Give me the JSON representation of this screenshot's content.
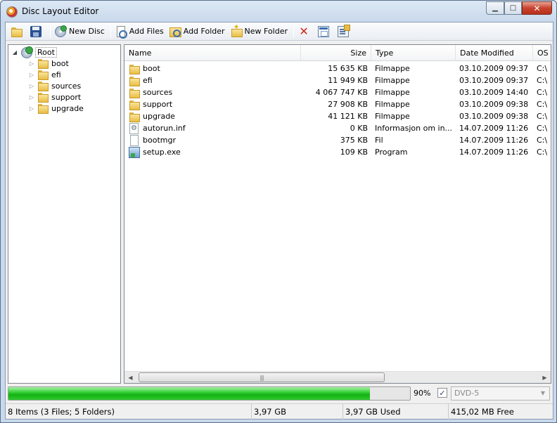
{
  "window": {
    "title": "Disc Layout Editor",
    "minimize_glyph": "▁",
    "maximize_glyph": "□",
    "close_glyph": "✕"
  },
  "toolbar": {
    "new_disc": "New Disc",
    "add_files": "Add Files",
    "add_folder": "Add Folder",
    "new_folder": "New Folder",
    "delete_glyph": "✕"
  },
  "tree": {
    "root": "Root",
    "items": [
      "boot",
      "efi",
      "sources",
      "support",
      "upgrade"
    ]
  },
  "list": {
    "columns": {
      "name": "Name",
      "size": "Size",
      "type": "Type",
      "date": "Date Modified",
      "os": "OS"
    },
    "rows": [
      {
        "icon": "folder-icon",
        "name": "boot",
        "size": "15 635 KB",
        "type": "Filmappe",
        "date": "03.10.2009 09:37",
        "os": "C:\\"
      },
      {
        "icon": "folder-icon",
        "name": "efi",
        "size": "11 949 KB",
        "type": "Filmappe",
        "date": "03.10.2009 09:37",
        "os": "C:\\"
      },
      {
        "icon": "folder-icon",
        "name": "sources",
        "size": "4 067 747 KB",
        "type": "Filmappe",
        "date": "03.10.2009 14:40",
        "os": "C:\\"
      },
      {
        "icon": "folder-icon",
        "name": "support",
        "size": "27 908 KB",
        "type": "Filmappe",
        "date": "03.10.2009 09:38",
        "os": "C:\\"
      },
      {
        "icon": "folder-icon",
        "name": "upgrade",
        "size": "41 121 KB",
        "type": "Filmappe",
        "date": "03.10.2009 09:38",
        "os": "C:\\"
      },
      {
        "icon": "settings-file-icon",
        "name": "autorun.inf",
        "size": "0 KB",
        "type": "Informasjon om in...",
        "date": "14.07.2009 11:26",
        "os": "C:\\"
      },
      {
        "icon": "file-icon",
        "name": "bootmgr",
        "size": "375 KB",
        "type": "Fil",
        "date": "14.07.2009 11:26",
        "os": "C:\\"
      },
      {
        "icon": "executable-icon",
        "name": "setup.exe",
        "size": "109 KB",
        "type": "Program",
        "date": "14.07.2009 11:26",
        "os": "C:\\"
      }
    ],
    "scroll_left": "◀",
    "scroll_right": "▶",
    "scroll_grip": "|||"
  },
  "capacity": {
    "percent_used": 0.9,
    "percent_label": "90%",
    "checkbox_checked": true,
    "checkbox_glyph": "✓",
    "disc_type": "DVD-5",
    "dropdown_glyph": "▼"
  },
  "status": {
    "items": "8 Items (3 Files; 5 Folders)",
    "total": "3,97 GB",
    "used": "3,97 GB Used",
    "free": "415,02 MB Free"
  },
  "colors": {
    "progress": "#2ccc2c",
    "title_bar": "#c9d9ec",
    "close_button": "#c7432d"
  }
}
